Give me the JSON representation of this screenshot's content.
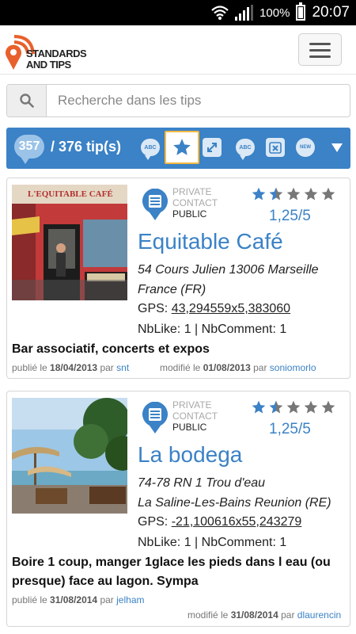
{
  "statusbar": {
    "battery": "100%",
    "time": "20:07"
  },
  "logo": {
    "line1": "STANDARDS",
    "line2": "AND TIPS"
  },
  "search": {
    "placeholder": "Recherche dans les tips"
  },
  "toolbar": {
    "shown_count": "357",
    "total_label": "/ 376 tip(s)",
    "abc_label": "ABC",
    "new_label": "NEW"
  },
  "colors": {
    "primary": "#3b82c6",
    "accent": "#f4b942"
  },
  "tips": [
    {
      "visibility_private": "PRIVATE",
      "visibility_contact": "CONTACT",
      "visibility_public": "PUBLIC",
      "rating": "1,25/5",
      "rating_value": 1.25,
      "title": "Equitable Café",
      "address_line1": "54 Cours Julien 13006 Marseille",
      "address_line2": "France (FR)",
      "gps_label": "GPS:",
      "gps_value": "43,294559x5,383060",
      "likes": "NbLike: 1 | NbComment: 1",
      "description": "Bar associatif, concerts et expos",
      "published_label": "publié le",
      "published_date": "18/04/2013",
      "published_by_label": "par",
      "published_by": "snt",
      "modified_label": "modifié le",
      "modified_date": "01/08/2013",
      "modified_by_label": "par",
      "modified_by": "soniomorlo",
      "photo_sign": "L'EQUITABLE CAFÉ"
    },
    {
      "visibility_private": "PRIVATE",
      "visibility_contact": "CONTACT",
      "visibility_public": "PUBLIC",
      "rating": "1,25/5",
      "rating_value": 1.25,
      "title": "La bodega",
      "address_line1": "74-78 RN 1 Trou d'eau",
      "address_line2": "La Saline-Les-Bains Reunion (RE)",
      "gps_label": "GPS:",
      "gps_value": "-21,100616x55,243279",
      "likes": "NbLike: 1 | NbComment: 1",
      "description": "Boire 1 coup, manger 1glace les pieds dans l eau (ou presque) face au lagon. Sympa",
      "published_label": "publié le",
      "published_date": "31/08/2014",
      "published_by_label": "par",
      "published_by": "jelham",
      "modified_label": "modifié le",
      "modified_date": "31/08/2014",
      "modified_by_label": "par",
      "modified_by": "dlaurencin"
    }
  ]
}
